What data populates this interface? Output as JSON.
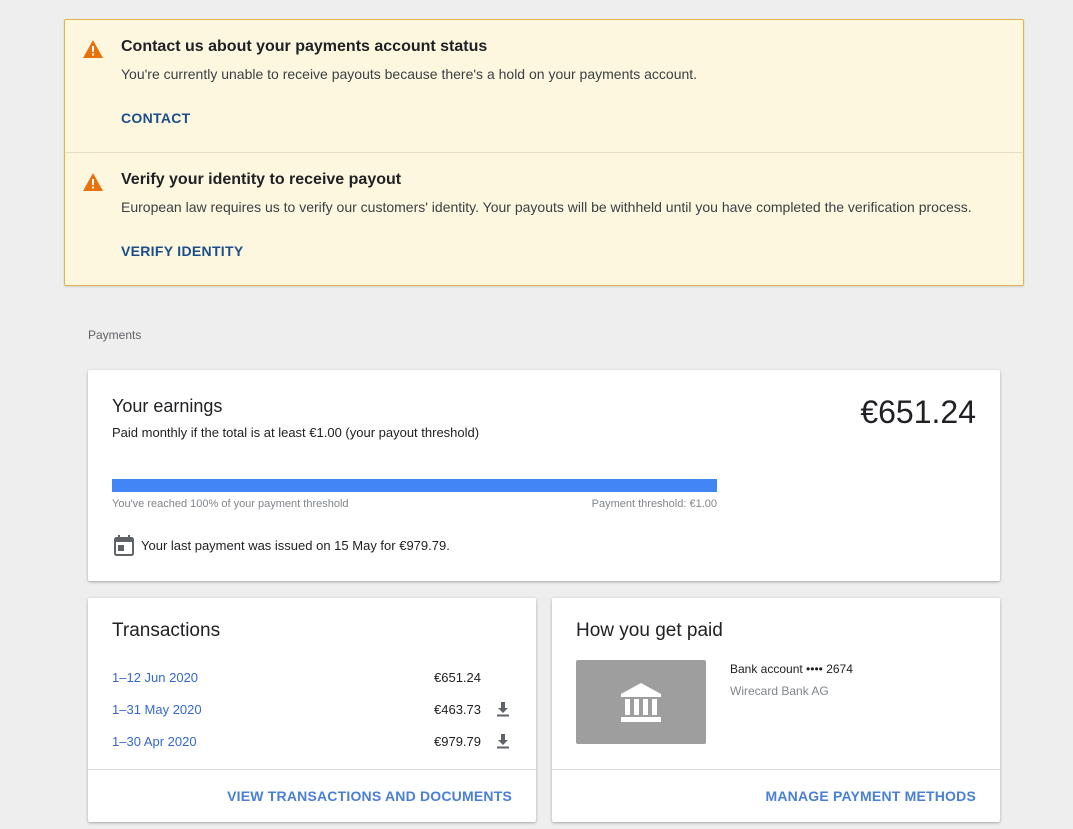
{
  "alerts": [
    {
      "title": "Contact us about your payments account status",
      "text": "You're currently unable to receive payouts because there's a hold on your payments account.",
      "action": "CONTACT",
      "icon": "warning-icon"
    },
    {
      "title": "Verify your identity to receive payout",
      "text": "European law requires us to verify our customers' identity. Your payouts will be withheld until you have completed the verification process.",
      "action": "VERIFY IDENTITY",
      "icon": "warning-icon"
    }
  ],
  "section_label": "Payments",
  "earnings": {
    "title": "Your earnings",
    "subtitle": "Paid monthly if the total is at least €1.00 (your payout threshold)",
    "amount": "€651.24",
    "progress_percent": 100,
    "progress_text": "You've reached 100% of your payment threshold",
    "threshold_text": "Payment threshold: €1.00",
    "last_payment": "Your last payment was issued on 15 May for €979.79.",
    "icon": "calendar-icon"
  },
  "transactions": {
    "title": "Transactions",
    "rows": [
      {
        "date": "1–12 Jun 2020",
        "amount": "€651.24",
        "download": false
      },
      {
        "date": "1–31 May 2020",
        "amount": "€463.73",
        "download": true
      },
      {
        "date": "1–30 Apr 2020",
        "amount": "€979.79",
        "download": true
      }
    ],
    "footer_link": "VIEW TRANSACTIONS AND DOCUMENTS"
  },
  "how_paid": {
    "title": "How you get paid",
    "account": "Bank account •••• 2674",
    "bank": "Wirecard Bank AG",
    "icon": "bank-icon",
    "footer_link": "MANAGE PAYMENT METHODS"
  },
  "colors": {
    "warning": "#e8710a",
    "progress": "#4285f4",
    "link": "#3367d6",
    "alert_bg": "#fef7e0"
  }
}
